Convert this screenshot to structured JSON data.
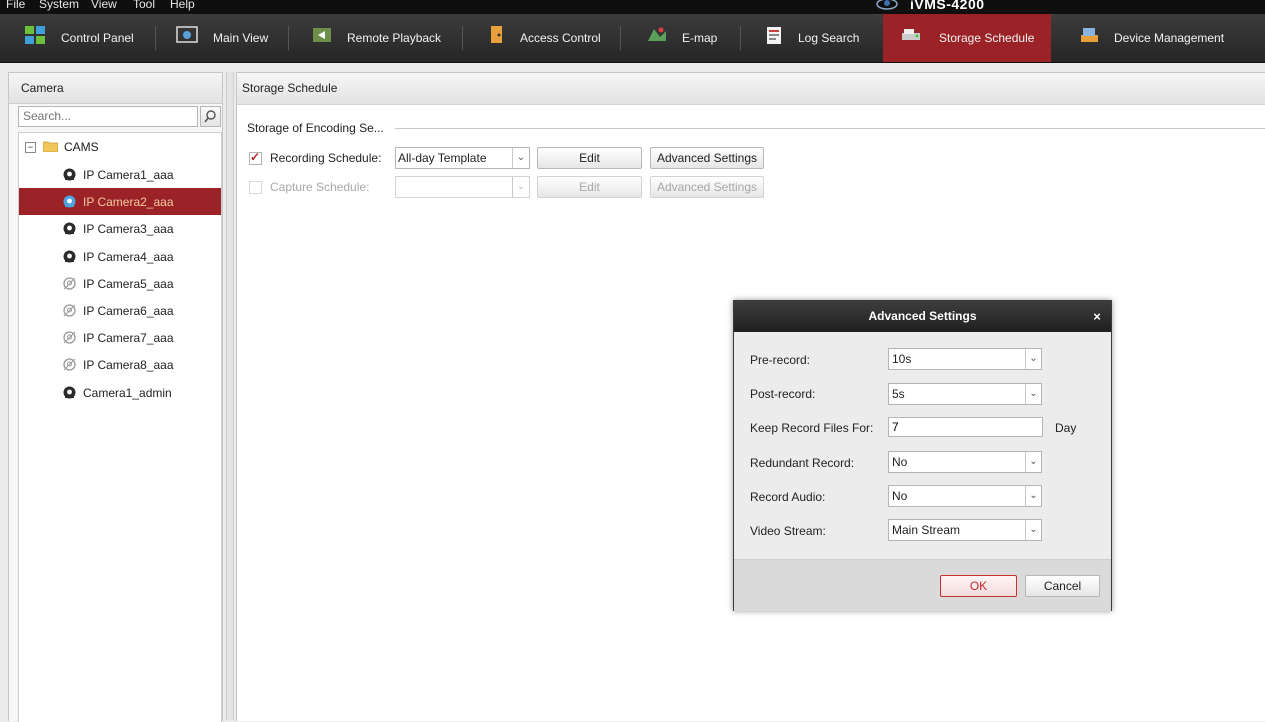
{
  "menu": [
    "File",
    "System",
    "View",
    "Tool",
    "Help"
  ],
  "app_title": "iVMS-4200",
  "tabs": [
    {
      "label": "Control Panel",
      "icon": "control-panel-icon"
    },
    {
      "label": "Main View",
      "icon": "main-view-icon"
    },
    {
      "label": "Remote Playback",
      "icon": "remote-playback-icon"
    },
    {
      "label": "Access Control",
      "icon": "access-control-icon"
    },
    {
      "label": "E-map",
      "icon": "emap-icon"
    },
    {
      "label": "Log Search",
      "icon": "log-search-icon"
    },
    {
      "label": "Storage Schedule",
      "icon": "storage-schedule-icon",
      "active": true
    },
    {
      "label": "Device Management",
      "icon": "device-management-icon"
    }
  ],
  "camera_panel": {
    "title": "Camera",
    "search_placeholder": "Search...",
    "root": "CAMS",
    "cameras": [
      {
        "label": "IP Camera1_aaa",
        "status": "online"
      },
      {
        "label": "IP Camera2_aaa",
        "status": "online",
        "selected": true
      },
      {
        "label": "IP Camera3_aaa",
        "status": "online"
      },
      {
        "label": "IP Camera4_aaa",
        "status": "online"
      },
      {
        "label": "IP Camera5_aaa",
        "status": "offline"
      },
      {
        "label": "IP Camera6_aaa",
        "status": "offline"
      },
      {
        "label": "IP Camera7_aaa",
        "status": "offline"
      },
      {
        "label": "IP Camera8_aaa",
        "status": "offline"
      },
      {
        "label": "Camera1_admin",
        "status": "online"
      }
    ]
  },
  "main": {
    "header": "Storage Schedule",
    "section_title": "Storage of Encoding Se...",
    "recording": {
      "label": "Recording Schedule:",
      "checked": true,
      "template": "All-day Template",
      "edit": "Edit",
      "advanced": "Advanced Settings"
    },
    "capture": {
      "label": "Capture Schedule:",
      "checked": false,
      "template": "",
      "edit": "Edit",
      "advanced": "Advanced Settings"
    }
  },
  "dialog": {
    "title": "Advanced Settings",
    "close": "×",
    "pre_record": {
      "label": "Pre-record:",
      "value": "10s"
    },
    "post_record": {
      "label": "Post-record:",
      "value": "5s"
    },
    "keep_files": {
      "label": "Keep Record Files For:",
      "value": "7",
      "unit": "Day"
    },
    "redundant": {
      "label": "Redundant Record:",
      "value": "No"
    },
    "audio": {
      "label": "Record Audio:",
      "value": "No"
    },
    "stream": {
      "label": "Video Stream:",
      "value": "Main Stream"
    },
    "ok": "OK",
    "cancel": "Cancel"
  },
  "colors": {
    "accent": "#9b2327",
    "toolbar": "#2e2e2e",
    "ok_border": "#c9302c"
  }
}
